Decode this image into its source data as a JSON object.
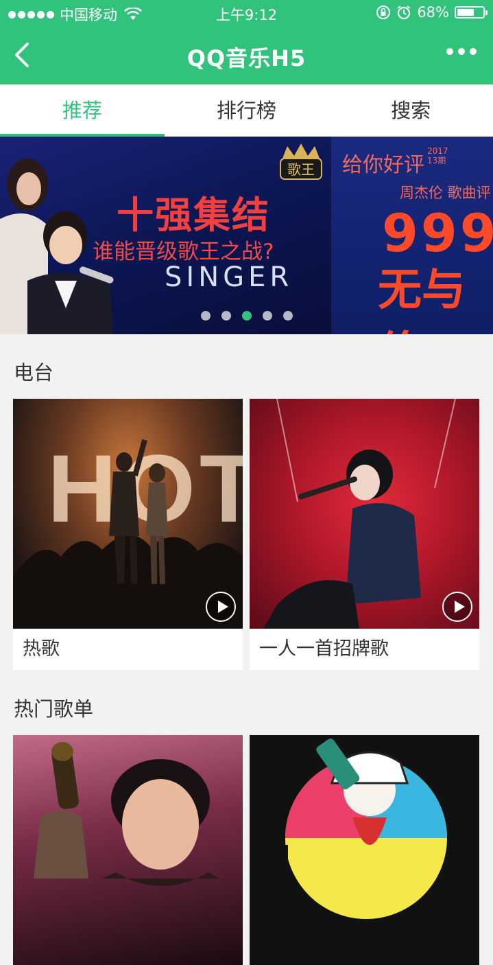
{
  "status_bar": {
    "carrier": "中国移动",
    "time": "上午9:12",
    "battery_percent": "68%",
    "battery_level": 0.68
  },
  "nav": {
    "title": "QQ音乐H5",
    "back_icon": "chevron-left-icon",
    "more_icon": "more-dots-icon"
  },
  "tabs": [
    {
      "label": "推荐",
      "active": true
    },
    {
      "label": "排行榜",
      "active": false
    },
    {
      "label": "搜索",
      "active": false
    }
  ],
  "banner": {
    "slide1": {
      "headline": "十强集结",
      "subtitle": "谁能晋级歌王之战?",
      "english": "SINGER",
      "logo_text": "歌王"
    },
    "slide2": {
      "title": "给你好评",
      "year": "2017",
      "issue": "13期",
      "artist": "周杰伦 歌曲评",
      "number": "999",
      "word": "无与伦"
    },
    "dots_count": 5,
    "active_dot": 3
  },
  "radio": {
    "title": "电台",
    "items": [
      {
        "label": "热歌",
        "art_text": "HOT"
      },
      {
        "label": "一人一首招牌歌"
      }
    ]
  },
  "playlists": {
    "title": "热门歌单"
  },
  "colors": {
    "brand": "#31c27c"
  }
}
